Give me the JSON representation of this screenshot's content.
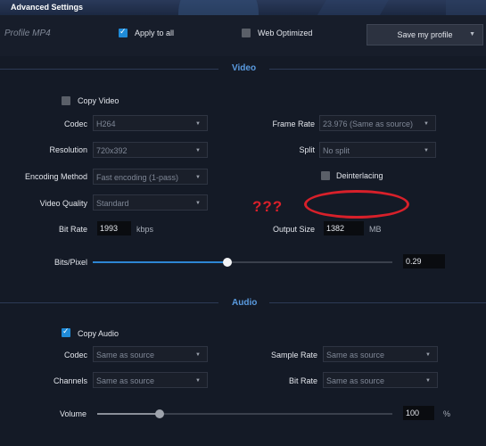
{
  "window": {
    "title": "Advanced Settings"
  },
  "header": {
    "profile_label": "Profile MP4",
    "apply_to_all_label": "Apply to all",
    "apply_to_all_checked": true,
    "web_optimized_label": "Web Optimized",
    "web_optimized_checked": false,
    "save_profile_label": "Save my profile"
  },
  "video": {
    "section_title": "Video",
    "copy_video_label": "Copy Video",
    "copy_video_checked": false,
    "codec_label": "Codec",
    "codec_value": "H264",
    "resolution_label": "Resolution",
    "resolution_value": "720x392",
    "encoding_method_label": "Encoding Method",
    "encoding_method_value": "Fast encoding (1-pass)",
    "video_quality_label": "Video Quality",
    "video_quality_value": "Standard",
    "bit_rate_label": "Bit Rate",
    "bit_rate_value": "1993",
    "bit_rate_unit": "kbps",
    "frame_rate_label": "Frame Rate",
    "frame_rate_value": "23.976 (Same as source)",
    "split_label": "Split",
    "split_value": "No split",
    "deinterlacing_label": "Deinterlacing",
    "deinterlacing_checked": false,
    "output_size_label": "Output Size",
    "output_size_value": "1382",
    "output_size_unit": "MB",
    "bits_pixel_label": "Bits/Pixel",
    "bits_pixel_value": "0.29",
    "bits_pixel_slider_fraction": 0.45
  },
  "annotation": {
    "text": "???",
    "color": "#d8202a"
  },
  "audio": {
    "section_title": "Audio",
    "copy_audio_label": "Copy Audio",
    "copy_audio_checked": true,
    "codec_label": "Codec",
    "codec_value": "Same as source",
    "channels_label": "Channels",
    "channels_value": "Same as source",
    "sample_rate_label": "Sample Rate",
    "sample_rate_value": "Same as source",
    "bit_rate_label": "Bit Rate",
    "bit_rate_value": "Same as source",
    "volume_label": "Volume",
    "volume_value": "100",
    "volume_unit": "%",
    "volume_slider_fraction": 0.21
  },
  "colors": {
    "accent": "#2d86d4",
    "section_title": "#5a9be0",
    "background": "#141a26"
  }
}
